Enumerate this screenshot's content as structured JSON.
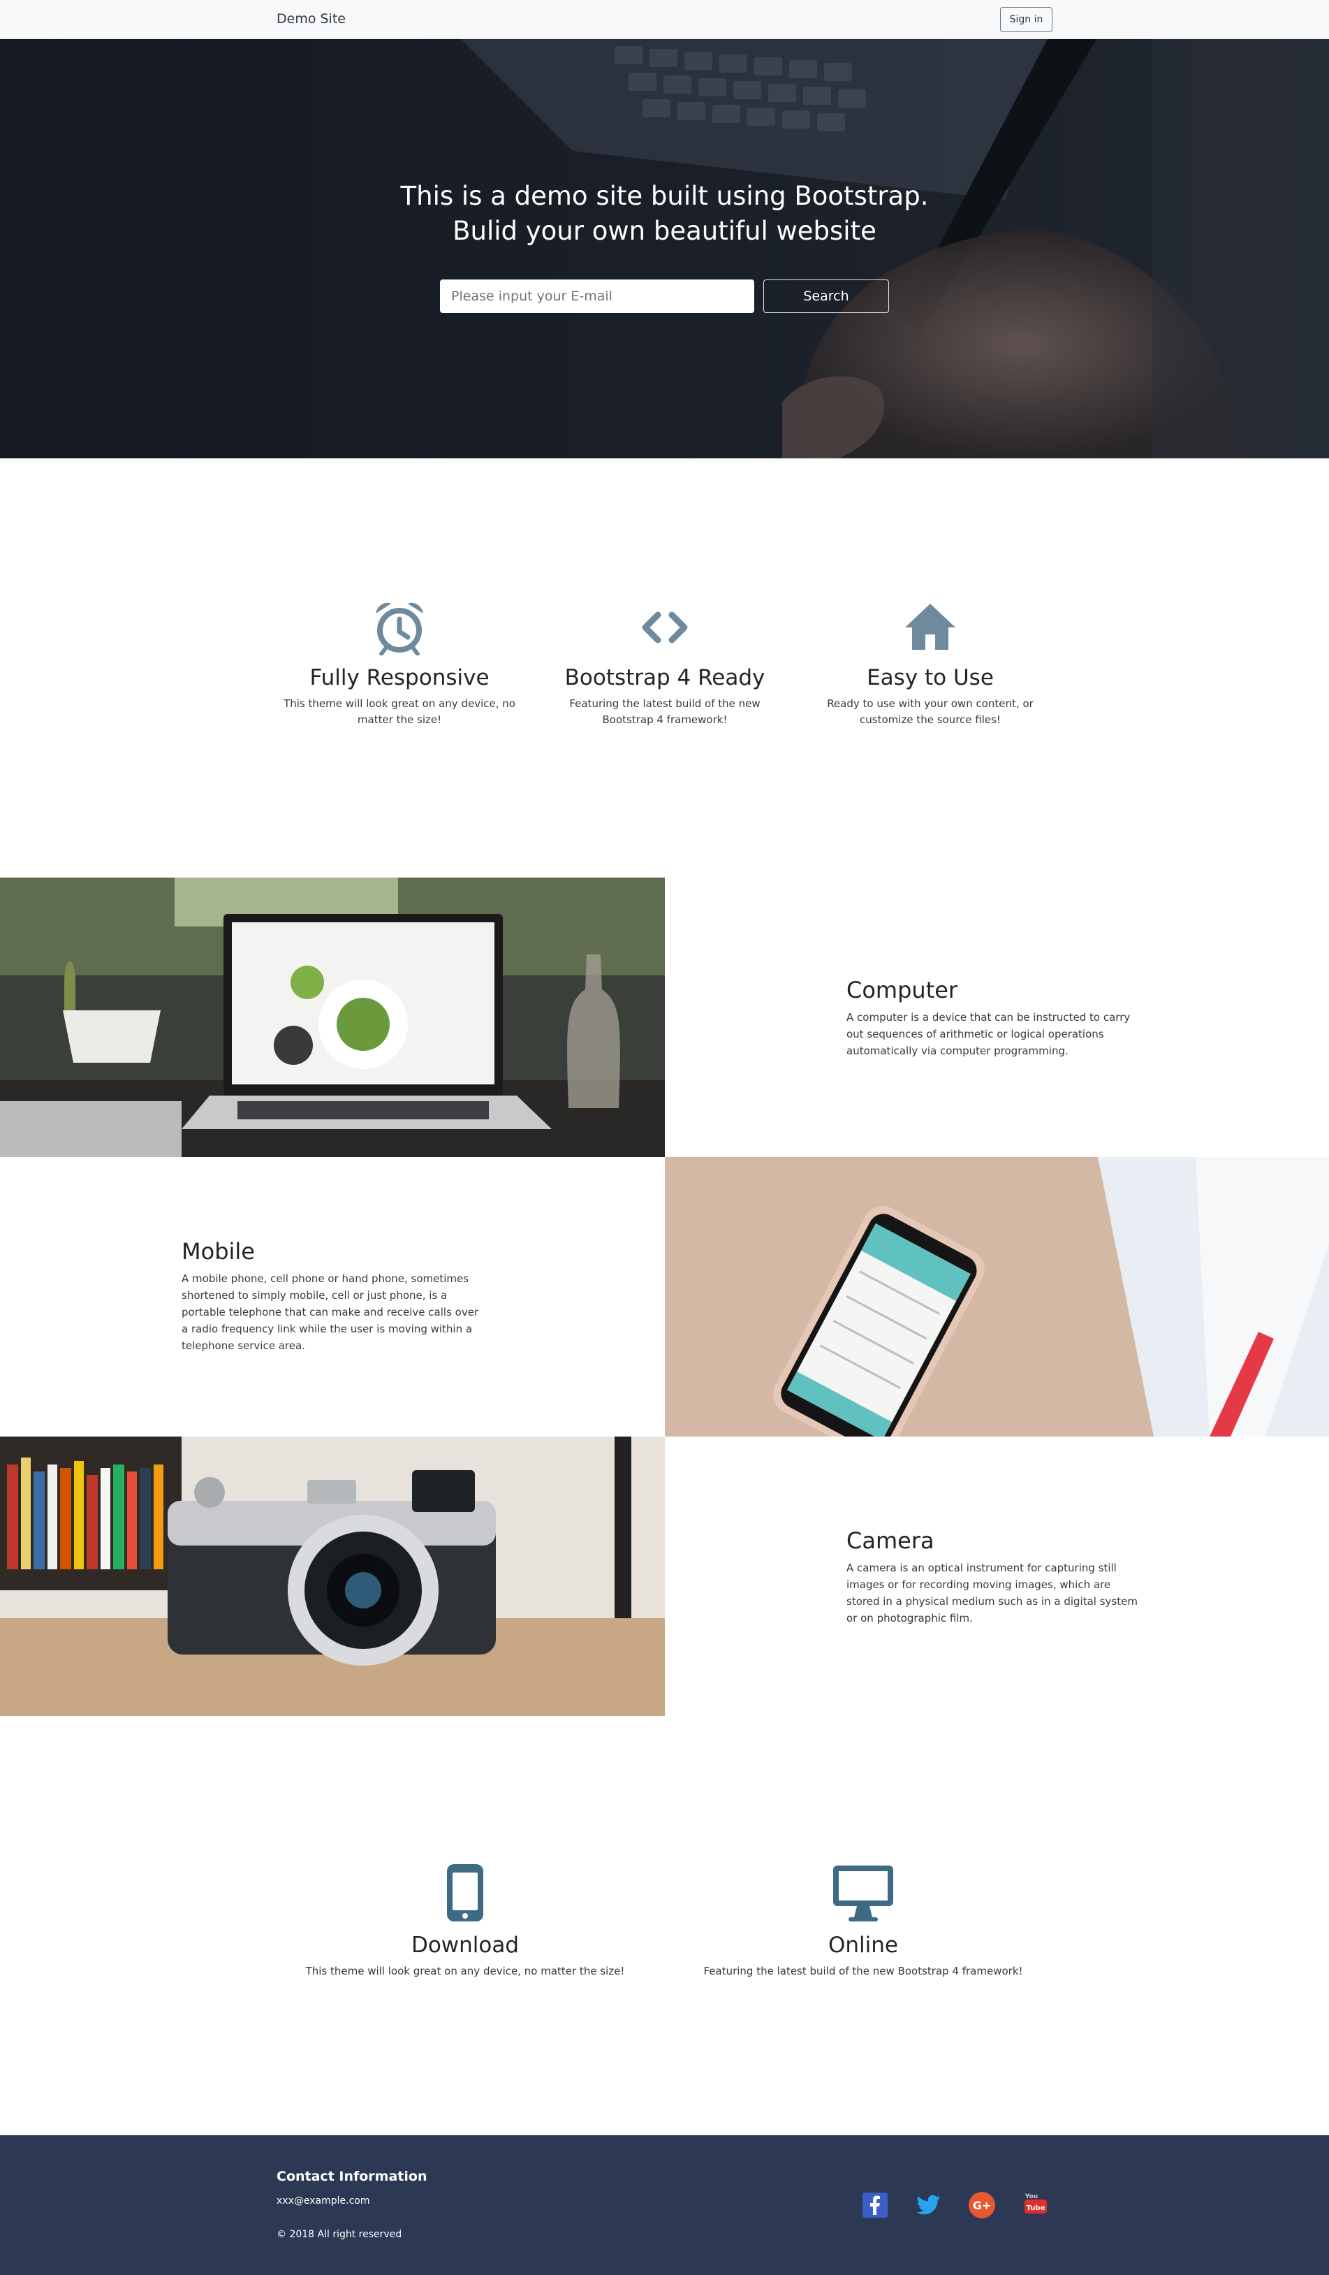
{
  "nav": {
    "brand": "Demo Site",
    "signin_label": "Sign in"
  },
  "hero": {
    "title_line1": "This is a demo site built using Bootstrap.",
    "title_line2": "Bulid your own beautiful website",
    "email_placeholder": "Please input your E-mail",
    "search_label": "Search"
  },
  "features": [
    {
      "icon": "alarm-clock-icon",
      "title": "Fully Responsive",
      "text": "This theme will look great on any device, no matter the size!"
    },
    {
      "icon": "code-icon",
      "title": "Bootstrap 4 Ready",
      "text": "Featuring the latest build of the new Bootstrap 4 framework!"
    },
    {
      "icon": "home-icon",
      "title": "Easy to Use",
      "text": "Ready to use with your own content, or customize the source files!"
    }
  ],
  "showcase": [
    {
      "title": "Computer",
      "text": "A computer is a device that can be instructed to carry out sequences of arithmetic or logical operations automatically via computer programming."
    },
    {
      "title": "Mobile",
      "text": "A mobile phone, cell phone or hand phone, sometimes shortened to simply mobile, cell or just phone, is a portable telephone that can make and receive calls over a radio frequency link while the user is moving within a telephone service area."
    },
    {
      "title": "Camera",
      "text": "A camera is an optical instrument for capturing still images or for recording moving images, which are stored in a physical medium such as in a digital system or on photographic film."
    }
  ],
  "downloads": [
    {
      "icon": "mobile-phone-icon",
      "title": "Download",
      "text": "This theme will look great on any device, no matter the size!"
    },
    {
      "icon": "desktop-monitor-icon",
      "title": "Online",
      "text": "Featuring the latest build of the new Bootstrap 4 framework!"
    }
  ],
  "footer": {
    "heading": "Contact Information",
    "email": "xxx@example.com",
    "copyright": "© 2018 All right reserved",
    "social": [
      "facebook-icon",
      "twitter-icon",
      "google-plus-icon",
      "youtube-icon"
    ]
  },
  "colors": {
    "icon": "#6f8a9c",
    "icon_dark": "#3f6a84",
    "footer_bg": "#2d3854",
    "hero_bg": "#171b22"
  }
}
